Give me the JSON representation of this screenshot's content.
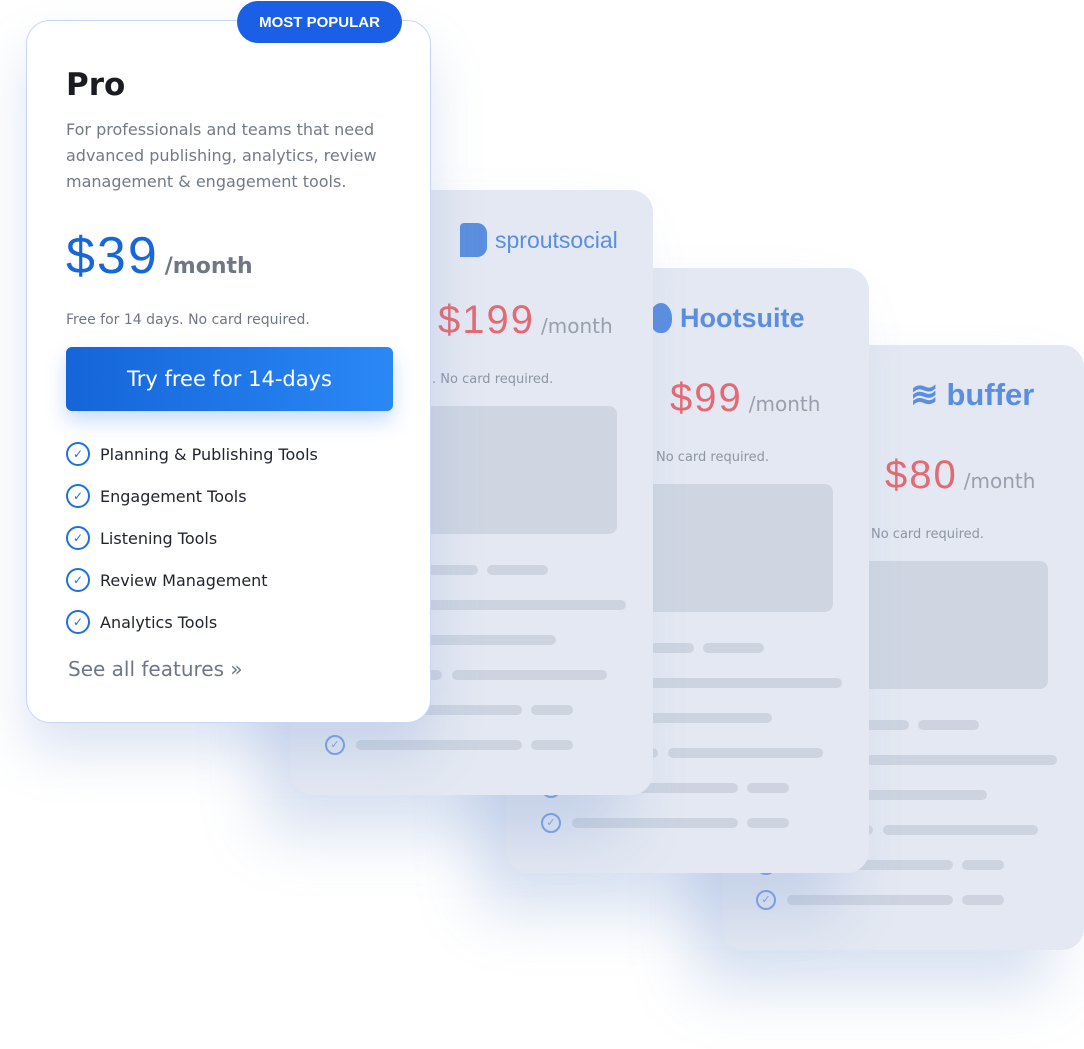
{
  "pro": {
    "badge": "MOST POPULAR",
    "title": "Pro",
    "description": "For professionals and teams that need advanced publishing, analytics, review management & engagement tools.",
    "price": "$39",
    "period": "/month",
    "trial_note": "Free for 14 days. No card required.",
    "cta": "Try free for 14-days",
    "features": [
      "Planning & Publishing Tools",
      "Engagement Tools",
      "Listening Tools",
      "Review Management",
      "Analytics Tools"
    ],
    "see_all": "See all features »",
    "accent": "#1767d8"
  },
  "competitors": [
    {
      "brand": "sproutsocial",
      "price": "$199",
      "period": "/month",
      "note": ". No card required."
    },
    {
      "brand": "Hootsuite",
      "price": "$99",
      "period": "/month",
      "note": "No card required."
    },
    {
      "brand": "buffer",
      "price": "$80",
      "period": "/month",
      "note": "No card required."
    }
  ],
  "colors": {
    "competitor_price": "#e36a75",
    "competitor_logo": "#5b8ee0"
  }
}
